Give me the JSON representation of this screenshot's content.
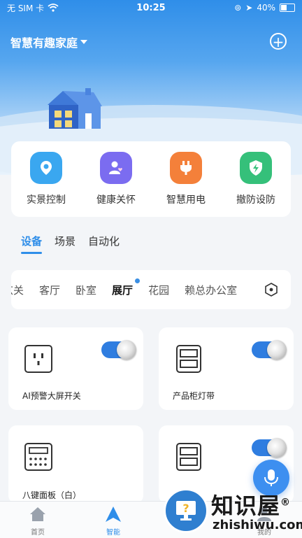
{
  "status_bar": {
    "carrier": "无 SIM 卡",
    "time": "10:25",
    "battery": "40%"
  },
  "header": {
    "home_name": "智慧有趣家庭",
    "dropdown_icon": "caret-down-icon",
    "add_icon": "plus-circle-icon"
  },
  "quick_actions": [
    {
      "label": "实景控制",
      "icon": "location-pin-icon",
      "color": "#3aa7f0"
    },
    {
      "label": "健康关怀",
      "icon": "person-heart-icon",
      "color": "#7b6cf0"
    },
    {
      "label": "智慧用电",
      "icon": "plug-icon",
      "color": "#f4803a"
    },
    {
      "label": "撤防设防",
      "icon": "shield-bolt-icon",
      "color": "#35c07a"
    }
  ],
  "tabs": [
    {
      "label": "设备",
      "active": true
    },
    {
      "label": "场景"
    },
    {
      "label": "自动化"
    }
  ],
  "rooms": [
    {
      "label": "玄关"
    },
    {
      "label": "客厅"
    },
    {
      "label": "卧室"
    },
    {
      "label": "展厅",
      "active": true
    },
    {
      "label": "花园"
    },
    {
      "label": "赖总办公室"
    }
  ],
  "devices": [
    {
      "name": "AI预警大屏开关",
      "icon": "socket-icon",
      "switch_on": true
    },
    {
      "name": "产品柜灯带",
      "icon": "cabinet-icon",
      "switch_on": true
    },
    {
      "name": "八键面板（白）",
      "icon": "keypad-icon",
      "switch_on": false
    },
    {
      "name": "",
      "icon": "cabinet-icon",
      "switch_on": true
    }
  ],
  "tabbar": [
    {
      "label": "首页",
      "icon": "home-icon"
    },
    {
      "label": "智能",
      "icon": "triangle-nav-icon",
      "active": true
    },
    {
      "label": "我的",
      "icon": "user-icon"
    }
  ],
  "watermark": {
    "title": "知识屋",
    "reg": "®",
    "sub": "zhishiwu.com"
  },
  "accent_color": "#2f8ee9"
}
